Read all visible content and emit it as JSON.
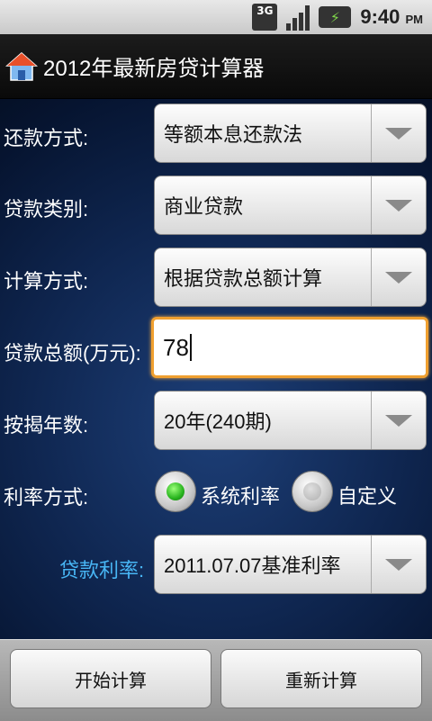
{
  "status_bar": {
    "network": "3G",
    "time": "9:40",
    "ampm": "PM"
  },
  "app": {
    "title": "2012年最新房贷计算器"
  },
  "form": {
    "repayment_method": {
      "label": "还款方式:",
      "value": "等额本息还款法"
    },
    "loan_type": {
      "label": "贷款类别:",
      "value": "商业贷款"
    },
    "calc_method": {
      "label": "计算方式:",
      "value": "根据贷款总额计算"
    },
    "loan_amount": {
      "label": "贷款总额(万元):",
      "value": "78"
    },
    "years": {
      "label": "按揭年数:",
      "value": "20年(240期)"
    },
    "rate_mode": {
      "label": "利率方式:",
      "options": [
        {
          "label": "系统利率",
          "selected": true
        },
        {
          "label": "自定义",
          "selected": false
        }
      ]
    },
    "loan_rate": {
      "label": "贷款利率:",
      "value": "2011.07.07基准利率"
    }
  },
  "buttons": {
    "calculate": "开始计算",
    "reset": "重新计算"
  },
  "colors": {
    "accent_label": "#48b6f5",
    "focus_border": "#f0a030",
    "radio_on": "#28b41e"
  }
}
